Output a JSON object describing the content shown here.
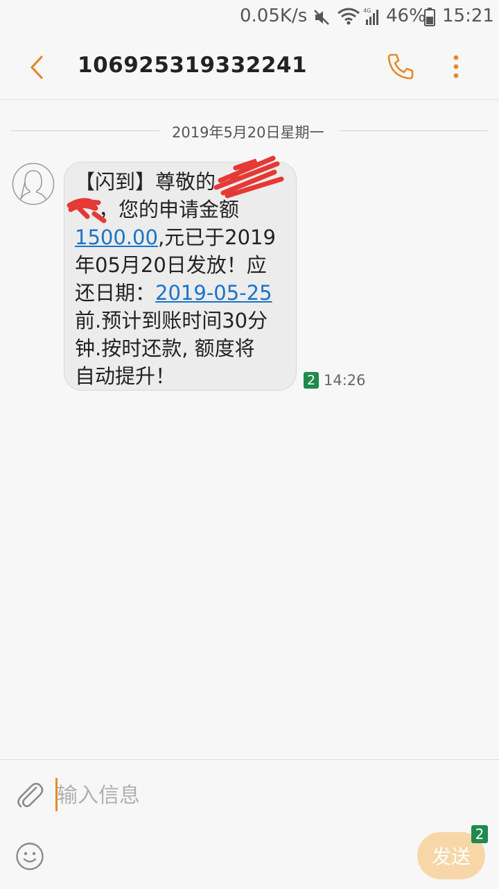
{
  "status_bar": {
    "network_speed": "0.05K/s",
    "battery_percent": "46%",
    "time": "15:21",
    "icons": [
      "mute-icon",
      "wifi-icon",
      "signal-4g-icon",
      "battery-icon"
    ]
  },
  "header": {
    "contact_number": "106925319332241",
    "icons": [
      "back-arrow-icon",
      "phone-icon",
      "more-vertical-icon"
    ],
    "accent_color": "#e58a2b"
  },
  "conversation": {
    "date_divider": "2019年5月20日星期一",
    "messages": [
      {
        "lines": [
          {
            "text": "【闪到】尊敬的"
          },
          {
            "text": "，您的申请金额"
          },
          {
            "link": "1500.00",
            "text": ",元已于2019"
          },
          {
            "text": "年05月20日发放！应"
          },
          {
            "prefix": "还日期：",
            "link": "2019-05-25"
          },
          {
            "text": "前.预计到账时间30分"
          },
          {
            "text": "钟.按时还款, 额度将"
          },
          {
            "text": "自动提升！"
          }
        ],
        "sim": "2",
        "time": "14:26"
      }
    ]
  },
  "composer": {
    "placeholder": "输入信息",
    "send_label": "发送",
    "send_sim": "2",
    "icons": [
      "paperclip-icon",
      "emoji-icon"
    ]
  },
  "colors": {
    "link": "#1a73c6",
    "sim_badge": "#1f8a4c",
    "send_button": "#f7d6a8"
  }
}
